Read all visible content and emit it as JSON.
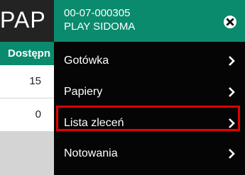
{
  "background": {
    "title": "PAP",
    "column_header": "Dostępn",
    "rows": [
      {
        "value": "15"
      },
      {
        "value": "0"
      }
    ]
  },
  "drawer": {
    "account_id": "00-07-000305",
    "account_name": "PLAY SIDOMA",
    "close_icon": "close-icon",
    "items": [
      {
        "label": "Gotówka",
        "icon": "chevron-right-icon"
      },
      {
        "label": "Papiery",
        "icon": "chevron-right-icon"
      },
      {
        "label": "Lista zleceń",
        "icon": "chevron-right-icon",
        "highlighted": true
      },
      {
        "label": "Notowania",
        "icon": "chevron-right-icon"
      }
    ]
  },
  "colors": {
    "accent": "#0a8b6d",
    "drawer_bg": "#050505",
    "header_bg": "#232323",
    "highlight": "#e40000"
  }
}
